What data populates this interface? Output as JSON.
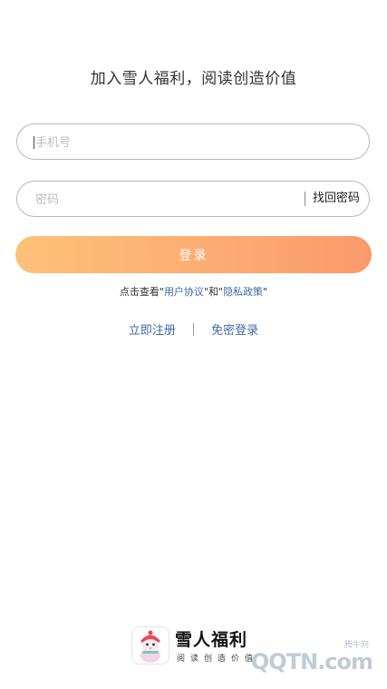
{
  "header": {
    "title": "加入雪人福利，阅读创造价值"
  },
  "form": {
    "phone_placeholder": "手机号",
    "password_placeholder": "密码",
    "find_password_label": "找回密码",
    "login_label": "登录"
  },
  "agreement": {
    "prefix": "点击查看",
    "q1": "\"",
    "user_agreement": "用户协议",
    "q2": "\"和\"",
    "privacy_policy": "隐私政策",
    "q3": "\""
  },
  "links": {
    "register_label": "立即注册",
    "sms_login_label": "免密登录"
  },
  "footer": {
    "brand_name": "雪人福利",
    "slogan": "阅读创造价值"
  },
  "watermark": {
    "small": "腾牛网",
    "big": "QQTN.com"
  },
  "colors": {
    "accent_start": "#fdc178",
    "accent_end": "#f99a6a",
    "link": "#3d6aa6"
  }
}
